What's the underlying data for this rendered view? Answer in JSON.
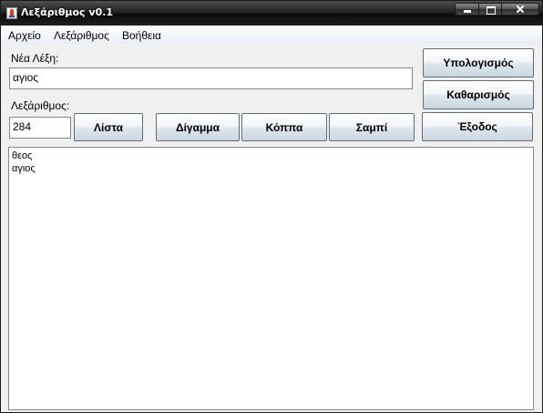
{
  "window": {
    "title": "Λεξάριθμος v0.1"
  },
  "menu": {
    "items": [
      "Αρχείο",
      "Λεξάριθμος",
      "Βοήθεια"
    ]
  },
  "form": {
    "new_word_label": "Νέα Λέξη:",
    "new_word_value": "αγιος",
    "lexarithm_label": "Λεξάριθμος:",
    "lexarithm_value": "284"
  },
  "buttons": {
    "list": "Λίστα",
    "digamma": "Δίγαμμα",
    "koppa": "Κόππα",
    "sampi": "Σαμπί",
    "calculate": "Υπολογισμός",
    "clear": "Καθαρισμός",
    "exit": "Έξοδος"
  },
  "output": {
    "lines": [
      "θεος",
      "αγιος"
    ]
  },
  "icons": {
    "app": "java-cup-icon",
    "minimize": "minimize-icon",
    "maximize": "maximize-icon",
    "close": "close-icon"
  }
}
